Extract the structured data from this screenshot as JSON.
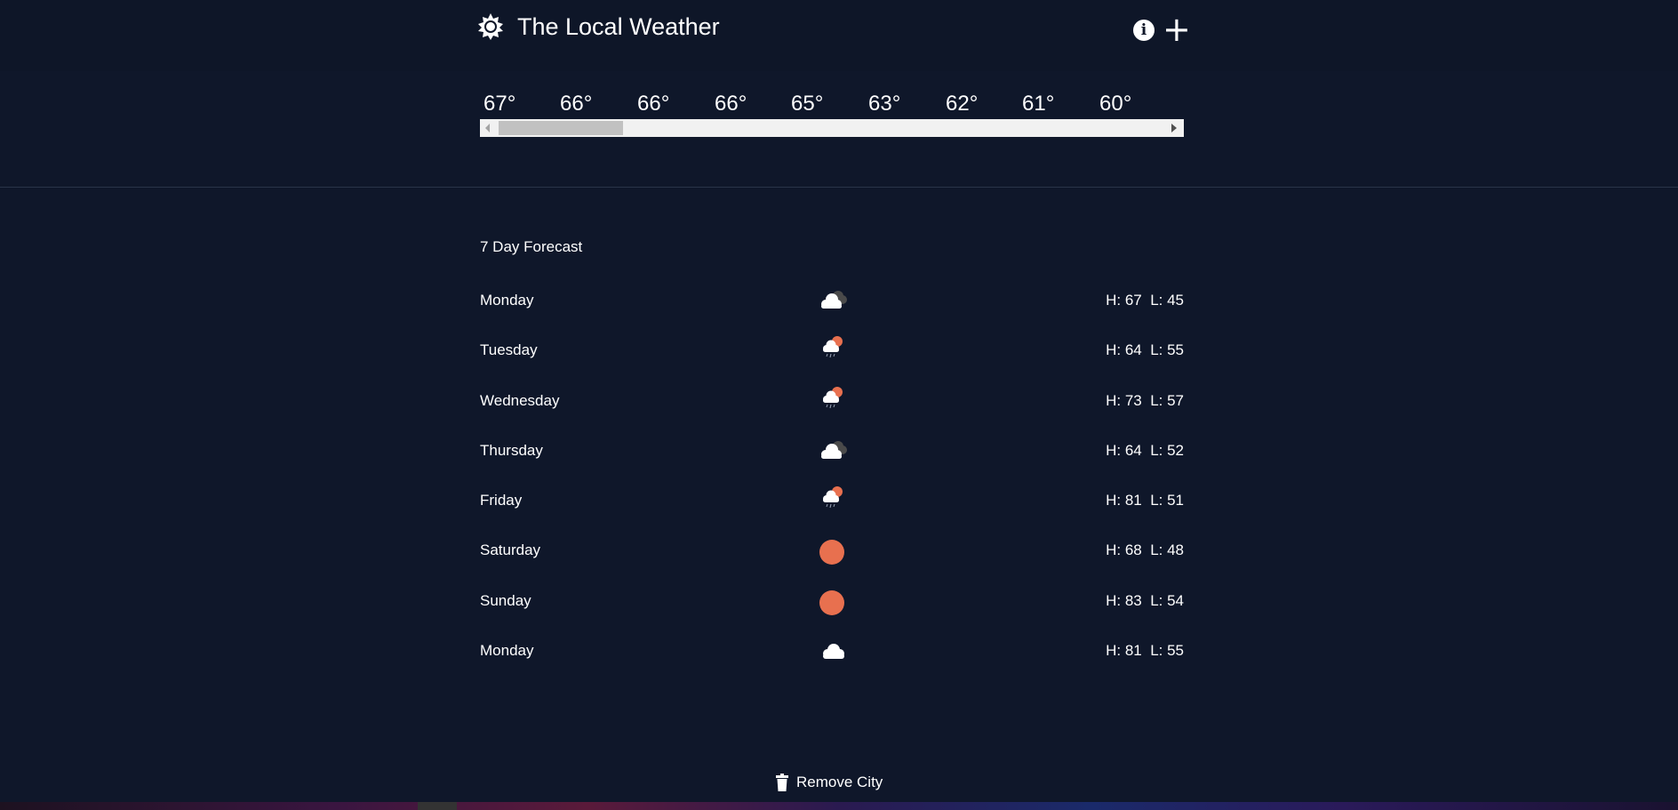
{
  "header": {
    "title": "The Local Weather",
    "brand_icon": "sun-gear-icon",
    "info_icon": "info-icon",
    "info_glyph": "i",
    "add_icon": "plus-icon",
    "add_glyph": "+"
  },
  "hourly": {
    "temps": [
      "67°",
      "66°",
      "66°",
      "66°",
      "65°",
      "63°",
      "62°",
      "61°",
      "60°"
    ],
    "scroll_position": 0.0
  },
  "forecast": {
    "title": "7 Day Forecast",
    "days": [
      {
        "day": "Monday",
        "icon": "cloudy-night-icon",
        "hl": "H: 67  L: 45"
      },
      {
        "day": "Tuesday",
        "icon": "rain-partly-sunny-icon",
        "hl": "H: 64  L: 55"
      },
      {
        "day": "Wednesday",
        "icon": "rain-partly-sunny-icon",
        "hl": "H: 73  L: 57"
      },
      {
        "day": "Thursday",
        "icon": "cloudy-night-icon",
        "hl": "H: 64  L: 52"
      },
      {
        "day": "Friday",
        "icon": "rain-partly-sunny-icon",
        "hl": "H: 81  L: 51"
      },
      {
        "day": "Saturday",
        "icon": "sun-icon",
        "hl": "H: 68  L: 48"
      },
      {
        "day": "Sunday",
        "icon": "sun-icon",
        "hl": "H: 83  L: 54"
      },
      {
        "day": "Monday",
        "icon": "cloud-icon",
        "hl": "H: 81  L: 55"
      }
    ]
  },
  "footer": {
    "remove_label": "Remove City",
    "remove_icon": "trash-icon"
  },
  "colors": {
    "background": "#0f172a",
    "header_background": "#0e1628",
    "sun": "#e8704f",
    "cloud": "#ffffff",
    "dark_cloud": "#4a4a4a"
  }
}
